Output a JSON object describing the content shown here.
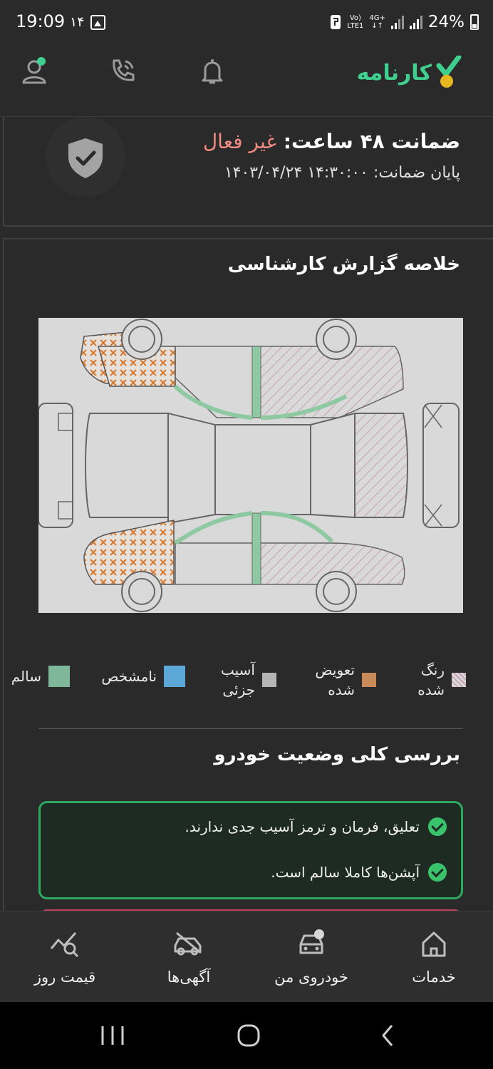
{
  "status_bar": {
    "time": "19:09",
    "date": "۱۴",
    "network_top": "Vo)",
    "network_bottom": "LTE1",
    "network_type": "4G+",
    "battery": "24%"
  },
  "header": {
    "logo_text": "کارنامه",
    "icons": [
      "profile-icon",
      "support-phone-icon",
      "notification-bell-icon"
    ],
    "colors": {
      "brand": "#3fcf8e",
      "logo_accent": "#e8b71f"
    }
  },
  "guarantee": {
    "title": "ضمانت ۴۸ ساعت:",
    "status": "غیر فعال",
    "end_label": "پایان ضمانت:",
    "end_value": "۱۴:۳۰:۰۰ ۱۴۰۳/۰۴/۲۴"
  },
  "report": {
    "title": "خلاصه گزارش کارشناسی",
    "legend": [
      {
        "line1": "رنگ",
        "line2": "شده",
        "color": "#c9a3b4"
      },
      {
        "line1": "تعویض",
        "line2": "شده",
        "color": "#c98a5a"
      },
      {
        "line1": "آسیب",
        "line2": "جزئی",
        "color": "#b5b5b5"
      },
      {
        "line1": "نامشخص",
        "line2": "",
        "color": "#5ba8d6"
      },
      {
        "line1": "سالم",
        "line2": "",
        "color": "#7fb79a"
      }
    ]
  },
  "overview": {
    "title": "بررسی کلی وضعیت خودرو",
    "checks": [
      "تعلیق، فرمان و ترمز آسیب جدی ندارند.",
      "آپشن‌ها کاملا سالم است."
    ]
  },
  "bottom_nav": {
    "items": [
      {
        "label": "خدمات",
        "icon": "home-icon"
      },
      {
        "label": "خودروی من",
        "icon": "my-car-icon"
      },
      {
        "label": "آگهی‌ها",
        "icon": "car-ads-icon"
      },
      {
        "label": "قیمت روز",
        "icon": "price-chart-icon"
      }
    ]
  }
}
